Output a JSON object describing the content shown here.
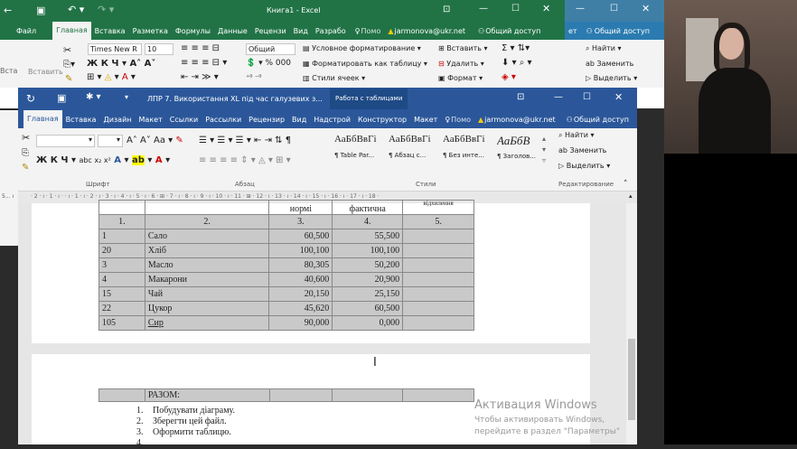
{
  "excel": {
    "title": "Книга1 - Excel",
    "user": "jarmonova@ukr.net",
    "share": "Общий доступ",
    "tellme": "Помо",
    "tabs": [
      "Файл",
      "Главная",
      "Вставка",
      "Разметка",
      "Формулы",
      "Данные",
      "Рецензи",
      "Вид",
      "Разрабо"
    ],
    "font_name": "Times New R",
    "font_size": "10",
    "number_format": "Общий",
    "paste_label": "Вставить",
    "cond_format": "Условное форматирование",
    "format_table": "Форматировать как таблицу",
    "cell_styles": "Стили ячеек",
    "insert": "Вставить",
    "delete": "Удалить",
    "format": "Формат",
    "find": "Найти",
    "replace": "Заменить",
    "select": "Выделить",
    "second_user_prefix": "ет",
    "second_share": "Общий доступ",
    "left_cut_label": "Вста"
  },
  "word": {
    "title": "ЛПР 7. Використання XL під час галузевих з...",
    "tools": "Работа с таблицами",
    "user": "jarmonova@ukr.net",
    "share": "Общий доступ",
    "tellme": "Помо",
    "tabs": [
      "Главная",
      "Вставка",
      "Дизайн",
      "Макет",
      "Ссылки",
      "Рассылки",
      "Рецензир",
      "Вид",
      "Надстрой",
      "Конструктор",
      "Макет"
    ],
    "groups": {
      "font": "Шрифт",
      "paragraph": "Абзац",
      "styles": "Стили",
      "editing": "Редактирование"
    },
    "styles": [
      {
        "sample": "АаБбВвГі",
        "name": "¶ Table Par..."
      },
      {
        "sample": "АаБбВвГі",
        "name": "¶ Абзац с..."
      },
      {
        "sample": "АаБбВвГі",
        "name": "¶ Без инте..."
      },
      {
        "sample": "АаБбВ",
        "name": "¶ Заголов..."
      }
    ],
    "find": "Найти",
    "replace": "Заменить",
    "select": "Выделить",
    "ruler_text": "· 2 · ı · 1 · ı · · ı · 1 · ı · 2 · ı · 3 · ı · 4 · ı · 5 · ı · 6 · ⊞ · 7 · ı · 8 · ı · 9 · ı · 10 · ı · 11 · ⊞ · 12 · ı · 13 · ı · 14 · ı · 15 · ı · 16 · ı · 17 · ı · 18 ·",
    "ruler_left": "5... ı"
  },
  "table": {
    "header_partial": [
      "нормі",
      "фактична",
      "відхилення"
    ],
    "numbers": [
      "1.",
      "2.",
      "3.",
      "4.",
      "5."
    ],
    "rows": [
      {
        "code": "1",
        "name": "Сало",
        "norm": "60,500",
        "fact": "55,500"
      },
      {
        "code": "20",
        "name": "Хліб",
        "norm": "100,100",
        "fact": "100,100"
      },
      {
        "code": "3",
        "name": "Масло",
        "norm": "80,305",
        "fact": "50,200"
      },
      {
        "code": "4",
        "name": "Макарони",
        "norm": "40,600",
        "fact": "20,900"
      },
      {
        "code": "15",
        "name": "Чай",
        "norm": "20,150",
        "fact": "25,150"
      },
      {
        "code": "22",
        "name": "Цукор",
        "norm": "45,620",
        "fact": "60,500"
      },
      {
        "code": "105",
        "name": "Сир",
        "norm": "90,000",
        "fact": "0,000"
      }
    ],
    "total_label": "РАЗОМ:"
  },
  "list": [
    "Побудувати діаграму.",
    "Зберегти цей файл.",
    "Оформити таблицю."
  ],
  "list_numbers": [
    "1.",
    "2.",
    "3.",
    "4."
  ],
  "activation": {
    "title": "Активация Windows",
    "line1": "Чтобы активировать Windows,",
    "line2": "перейдите в раздел \"Параметры\""
  },
  "colors": {
    "excel": "#217346",
    "word": "#2b579a"
  }
}
